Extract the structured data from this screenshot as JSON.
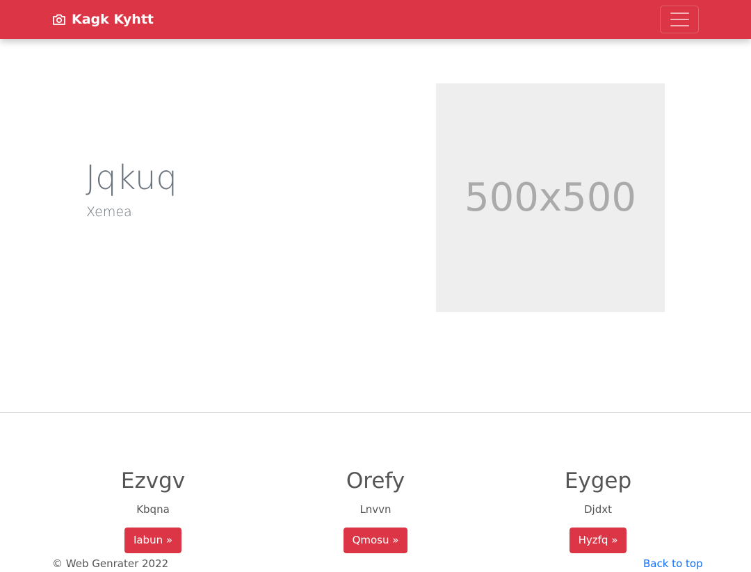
{
  "navbar": {
    "brand": "Kagk Kyhtt",
    "brand_icon": "camera-icon",
    "toggler_icon": "hamburger-icon",
    "color": "#dc3545"
  },
  "hero": {
    "title": "Jqkuq",
    "subtitle": "Xemea",
    "image_text": "500x500"
  },
  "features": [
    {
      "heading": "Ezvgv",
      "text": "Kbqna",
      "button": "Iabun »"
    },
    {
      "heading": "Orefy",
      "text": "Lnvvn",
      "button": "Qmosu »"
    },
    {
      "heading": "Eygep",
      "text": "Djdxt",
      "button": "Hyzfq »"
    }
  ],
  "footer": {
    "copyright": "© Web Genrater 2022",
    "back_to_top": "Back to top"
  }
}
